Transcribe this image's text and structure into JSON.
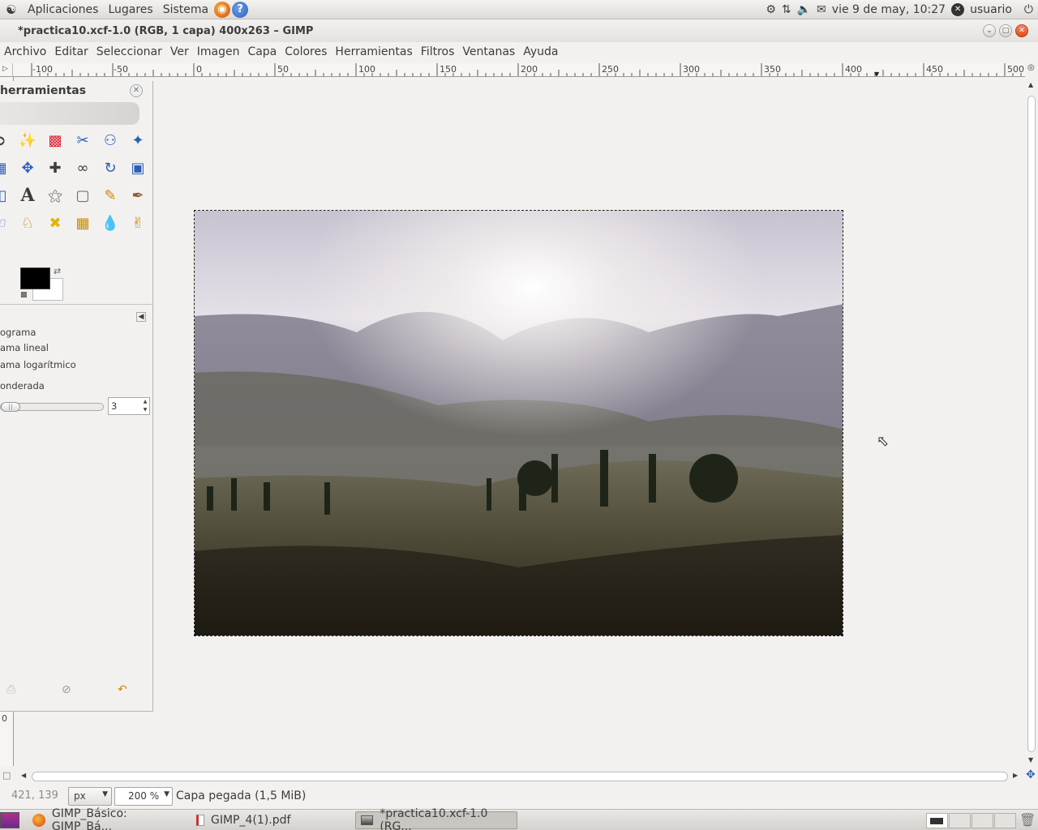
{
  "top_panel": {
    "menus": [
      "Aplicaciones",
      "Lugares",
      "Sistema"
    ],
    "datetime": "vie  9 de may, 10:27",
    "user": "usuario"
  },
  "window": {
    "title": "*practica10.xcf-1.0 (RGB, 1 capa) 400x263 – GIMP"
  },
  "menu_bar": {
    "items": [
      "Archivo",
      "Editar",
      "Seleccionar",
      "Ver",
      "Imagen",
      "Capa",
      "Colores",
      "Herramientas",
      "Filtros",
      "Ventanas",
      "Ayuda"
    ]
  },
  "ruler": {
    "labels": [
      "-100",
      "-50",
      "0",
      "50",
      "100",
      "150",
      "200",
      "250",
      "300",
      "350",
      "400",
      "450",
      "500"
    ],
    "v_label": "0"
  },
  "toolbox": {
    "title": "herramientas",
    "options": {
      "opt1": "ograma",
      "opt2": "ama lineal",
      "opt3": "ama logarítmico",
      "opt4": "onderada",
      "spin_value": "3"
    }
  },
  "status_bar": {
    "coords": "421, 139",
    "unit": "px",
    "zoom": "200 %",
    "message": "Capa pegada (1,5 MiB)"
  },
  "taskbar": {
    "tasks": [
      {
        "label": "GIMP_Básico: GIMP_Bá...",
        "active": false
      },
      {
        "label": "GIMP_4(1).pdf",
        "active": false
      },
      {
        "label": "*practica10.xcf-1.0 (RG...",
        "active": true
      }
    ]
  },
  "colors": {
    "foreground": "#000000",
    "background": "#ffffff",
    "selection_marching_ants": "#d6c000"
  }
}
